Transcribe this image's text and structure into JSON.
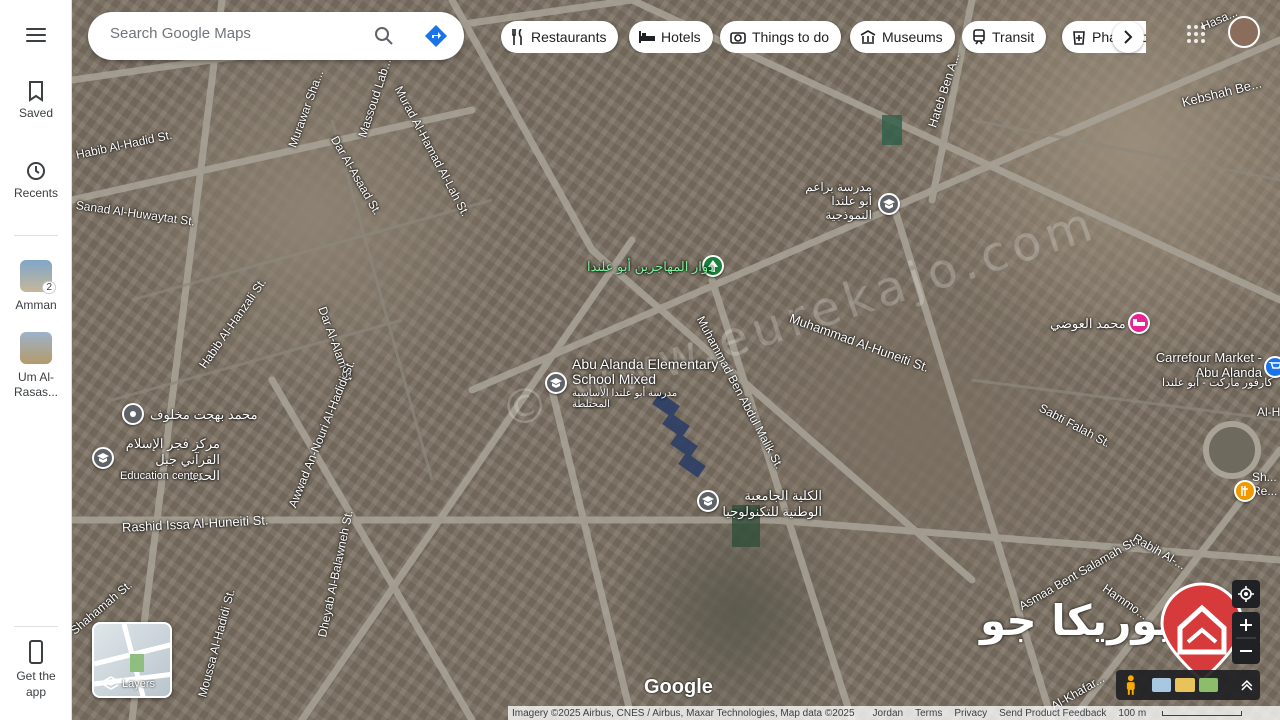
{
  "search": {
    "placeholder": "Search Google Maps"
  },
  "rail": {
    "saved": "Saved",
    "recents": "Recents",
    "recent_places": [
      {
        "label": "Amman",
        "badge": "2"
      },
      {
        "label": "Um Al-Rasas..."
      }
    ],
    "get_app": "Get the app"
  },
  "chips": [
    {
      "label": "Restaurants",
      "icon": "fork-knife-icon"
    },
    {
      "label": "Hotels",
      "icon": "bed-icon"
    },
    {
      "label": "Things to do",
      "icon": "camera-icon"
    },
    {
      "label": "Museums",
      "icon": "museum-icon"
    },
    {
      "label": "Transit",
      "icon": "train-icon"
    },
    {
      "label": "Pharmacies",
      "icon": "pharmacy-icon"
    }
  ],
  "streets": [
    "Habib Al-Hadid St.",
    "Sanad Al-Huwaytat St.",
    "Murawar Sha...",
    "Dar Al-Asaad St.",
    "Massoud Lab...",
    "Murad Al-Hamad Al-Lah St.",
    "Habib Al-Hanzali St.",
    "Dar Al-Alam St.",
    "Awwad An-Nouri Al-Hadidi St.",
    "Rashid Issa Al-Huneiti St.",
    "Shahamah St.",
    "Moussa Al-Hadidi St.",
    "Dheyab Al-Balawneh St.",
    "Muhammad Al-Huneiti St.",
    "Muhammad Ben Abdul Malik St.",
    "Sabti Falah St.",
    "Asmaa Bent Salamah St.",
    "Rabih Al-...",
    "Hateb Ben A...",
    "Kebshah Be...",
    "Hasa...",
    "Al-Khafar...",
    "Hammo...",
    "Al-H...",
    "Sh... Re..."
  ],
  "places": {
    "abu_alanda_school": "Abu Alanda Elementary School Mixed",
    "abu_alanda_school_ar": "مدرسة أبو علندا الأساسية المختلطة",
    "school_top_ar": "مدرسة براعم أبو علندا النموذجية",
    "roundabout_ar": "دوار المهاجرين أبو علندا",
    "mohammad_awadi_ar": "محمد العوضي",
    "carrefour": "Carrefour Market - Abu Alanda",
    "carrefour_ar": "كارفور ماركت - أبو علندا",
    "mohammad_bahjat_ar": "محمد بهجت مخلوف",
    "fajr_center_ar": "مركز فجر الإسلام القرآني جبل الحديد",
    "fajr_center_sub": "Education center",
    "college_ar": "الكلية الجامعية الوطنية للتكنولوجيا"
  },
  "watermark": "© www.eurekajo.com",
  "layers": {
    "label": "Layers"
  },
  "google": "Google",
  "brand_logo": "يوريكا جو",
  "footer": {
    "imagery": "Imagery ©2025 Airbus, CNES / Airbus, Maxar Technologies, Map data ©2025",
    "country": "Jordan",
    "terms": "Terms",
    "privacy": "Privacy",
    "feedback": "Send Product Feedback",
    "scale": "100 m"
  },
  "colors": {
    "school_pin": "#5f6368",
    "park_pin": "#188038",
    "hotel_pin": "#e52592",
    "shop_pin": "#1a73e8",
    "food_pin": "#f29900",
    "logo_red": "#d63a3a"
  }
}
